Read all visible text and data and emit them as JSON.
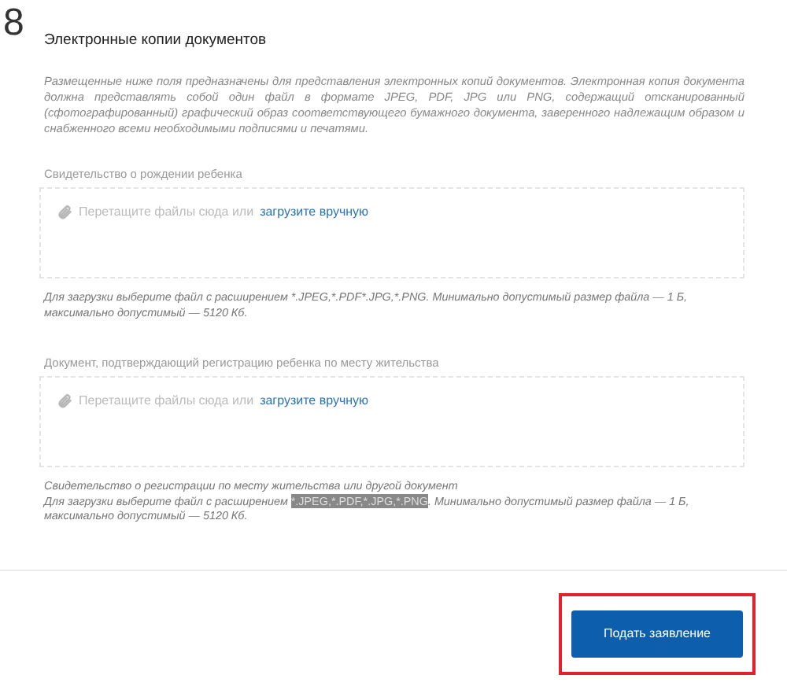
{
  "step": {
    "number": "8",
    "title": "Электронные копии документов"
  },
  "description": "Размещенные ниже поля предназначены для представления электронных копий документов. Электронная копия документа должна представлять собой один файл в формате JPEG, PDF, JPG или PNG, содержащий отсканированный (сфотографированный) графический образ соответствующего бумажного документа, заверенного надлежащим образом и снабженного всеми необходимыми подписями и печатями.",
  "uploads": [
    {
      "label": "Свидетельство о рождении ребенка",
      "drop_text": "Перетащите файлы сюда или",
      "link": "загрузите вручную",
      "hint_before": "Для загрузки выберите файл с расширением *.JPEG,*.PDF*.JPG,*.PNG. Минимально допустимый размер файла — 1 Б, максимально допустимый — 5120 Кб."
    },
    {
      "label": "Документ, подтверждающий регистрацию ребенка по месту жительства",
      "drop_text": "Перетащите файлы сюда или",
      "link": "загрузите вручную",
      "note": "Свидетельство о регистрации по месту жительства или другой документ",
      "hint_before": "Для загрузки выберите файл с расширением",
      "hint_highlight": "*.JPEG,*.PDF,*.JPG,*.PNG",
      "hint_after": ". Минимально допустимый размер файла — 1 Б, максимально допустимый — 5120 Кб."
    }
  ],
  "submit": {
    "label": "Подать заявление",
    "highlighted": true
  }
}
